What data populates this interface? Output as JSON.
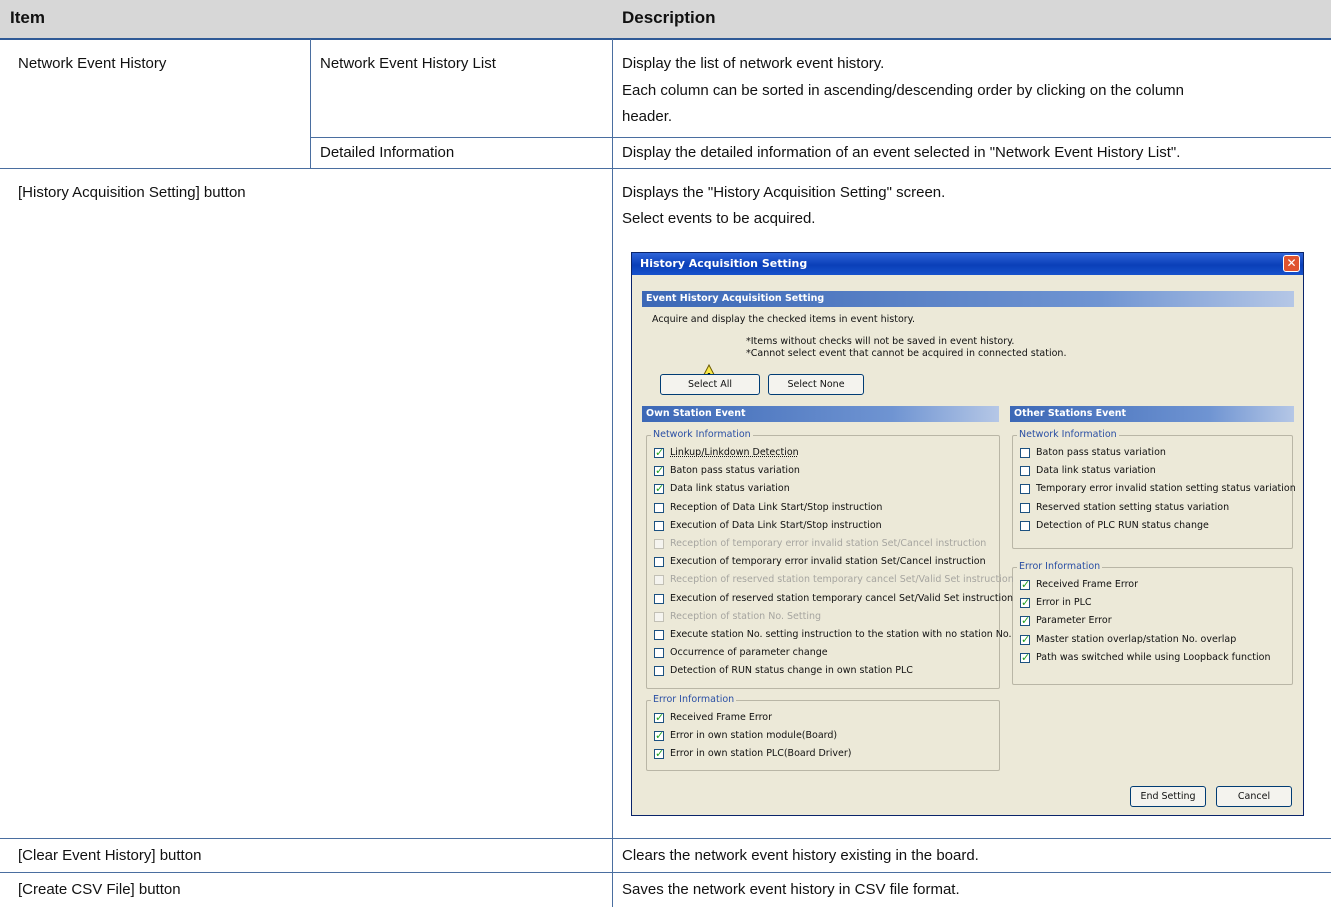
{
  "table": {
    "headers": {
      "item": "Item",
      "description": "Description"
    },
    "rows": {
      "network_event_history": {
        "item": "Network Event History",
        "sub1": {
          "item": "Network Event History List",
          "desc_line1": "Display the list of network event history.",
          "desc_line2": "Each column can be sorted in ascending/descending order by clicking on the column",
          "desc_line3": "header."
        },
        "sub2": {
          "item": "Detailed Information",
          "desc": "Display the detailed information of an event selected in \"Network Event History List\"."
        }
      },
      "history_acquisition": {
        "item": "[History Acquisition Setting] button",
        "desc_line1": "Displays the \"History Acquisition Setting\" screen.",
        "desc_line2": "Select events to be acquired."
      },
      "clear": {
        "item": "[Clear Event History] button",
        "desc": "Clears the network event history existing in the board."
      },
      "csv": {
        "item": "[Create CSV File] button",
        "desc": "Saves the network event history in CSV file format."
      }
    }
  },
  "dialog": {
    "title": "History Acquisition Setting",
    "close_glyph": "✕",
    "section_title": "Event History Acquisition Setting",
    "instruction": "Acquire and display the checked items in event history.",
    "note1": "*Items without checks will not be saved in event history.",
    "note2": "*Cannot select event that cannot be acquired in connected station.",
    "select_all": "Select All",
    "select_none": "Select None",
    "own_station": {
      "title": "Own Station Event",
      "network_legend": "Network Information",
      "network_items": [
        {
          "label": "Linkup/Linkdown Detection",
          "checked": true,
          "disabled": false,
          "focused": true
        },
        {
          "label": "Baton pass status variation",
          "checked": true,
          "disabled": false
        },
        {
          "label": "Data link status variation",
          "checked": true,
          "disabled": false
        },
        {
          "label": "Reception of Data Link Start/Stop instruction",
          "checked": false,
          "disabled": false
        },
        {
          "label": "Execution of Data Link Start/Stop instruction",
          "checked": false,
          "disabled": false
        },
        {
          "label": "Reception of temporary error invalid station Set/Cancel instruction",
          "checked": false,
          "disabled": true
        },
        {
          "label": "Execution of temporary error invalid station Set/Cancel instruction",
          "checked": false,
          "disabled": false
        },
        {
          "label": "Reception of reserved station temporary cancel Set/Valid Set instruction",
          "checked": false,
          "disabled": true
        },
        {
          "label": "Execution of reserved station temporary cancel Set/Valid Set instruction",
          "checked": false,
          "disabled": false
        },
        {
          "label": "Reception of station No. Setting",
          "checked": false,
          "disabled": true
        },
        {
          "label": "Execute station No. setting instruction to the station with no station No.",
          "checked": false,
          "disabled": false
        },
        {
          "label": "Occurrence of parameter change",
          "checked": false,
          "disabled": false
        },
        {
          "label": "Detection of RUN status change in own station PLC",
          "checked": false,
          "disabled": false
        }
      ],
      "error_legend": "Error Information",
      "error_items": [
        {
          "label": "Received Frame Error",
          "checked": true
        },
        {
          "label": "Error in own station module(Board)",
          "checked": true
        },
        {
          "label": "Error in own station PLC(Board Driver)",
          "checked": true
        }
      ]
    },
    "other_stations": {
      "title": "Other Stations Event",
      "network_legend": "Network Information",
      "network_items": [
        {
          "label": "Baton pass status variation",
          "checked": false
        },
        {
          "label": "Data link status variation",
          "checked": false
        },
        {
          "label": "Temporary error invalid station setting status variation",
          "checked": false
        },
        {
          "label": "Reserved station setting status variation",
          "checked": false
        },
        {
          "label": "Detection of PLC RUN status change",
          "checked": false
        }
      ],
      "error_legend": "Error Information",
      "error_items": [
        {
          "label": "Received Frame Error",
          "checked": true
        },
        {
          "label": "Error in PLC",
          "checked": true
        },
        {
          "label": "Parameter Error",
          "checked": true
        },
        {
          "label": "Master station overlap/station No. overlap",
          "checked": true
        },
        {
          "label": "Path was switched while using Loopback function",
          "checked": true
        }
      ]
    },
    "end_setting": "End Setting",
    "cancel": "Cancel",
    "check_glyph": "✓",
    "warning_glyph": "!"
  }
}
